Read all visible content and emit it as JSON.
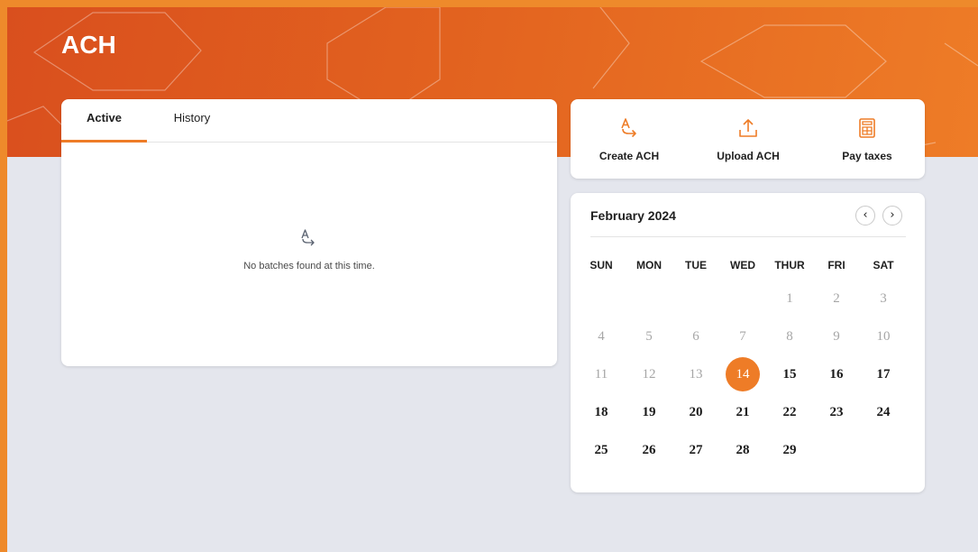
{
  "page": {
    "title": "ACH"
  },
  "colors": {
    "accent": "#ee7c27",
    "banner_start": "#d94f1e",
    "banner_end": "#ee7c27",
    "background": "#e4e6ed"
  },
  "tabs": [
    {
      "label": "Active",
      "active": true
    },
    {
      "label": "History",
      "active": false
    }
  ],
  "batches": {
    "empty_icon": "ach-transfer-icon",
    "empty_message": "No batches found at this time."
  },
  "actions": [
    {
      "label": "Create ACH",
      "icon": "ach-transfer-icon"
    },
    {
      "label": "Upload ACH",
      "icon": "upload-icon"
    },
    {
      "label": "Pay taxes",
      "icon": "calculator-icon"
    }
  ],
  "calendar": {
    "month_label": "February 2024",
    "prev_icon": "chevron-left-icon",
    "next_icon": "chevron-right-icon",
    "weekdays": [
      "SUN",
      "MON",
      "TUE",
      "WED",
      "THUR",
      "FRI",
      "SAT"
    ],
    "selected_day": "14",
    "weeks": [
      [
        "",
        "",
        "",
        "",
        "1",
        "2",
        "3"
      ],
      [
        "4",
        "5",
        "6",
        "7",
        "8",
        "9",
        "10"
      ],
      [
        "11",
        "12",
        "13",
        "14",
        "15",
        "16",
        "17"
      ],
      [
        "18",
        "19",
        "20",
        "21",
        "22",
        "23",
        "24"
      ],
      [
        "25",
        "26",
        "27",
        "28",
        "29",
        "",
        ""
      ]
    ]
  }
}
